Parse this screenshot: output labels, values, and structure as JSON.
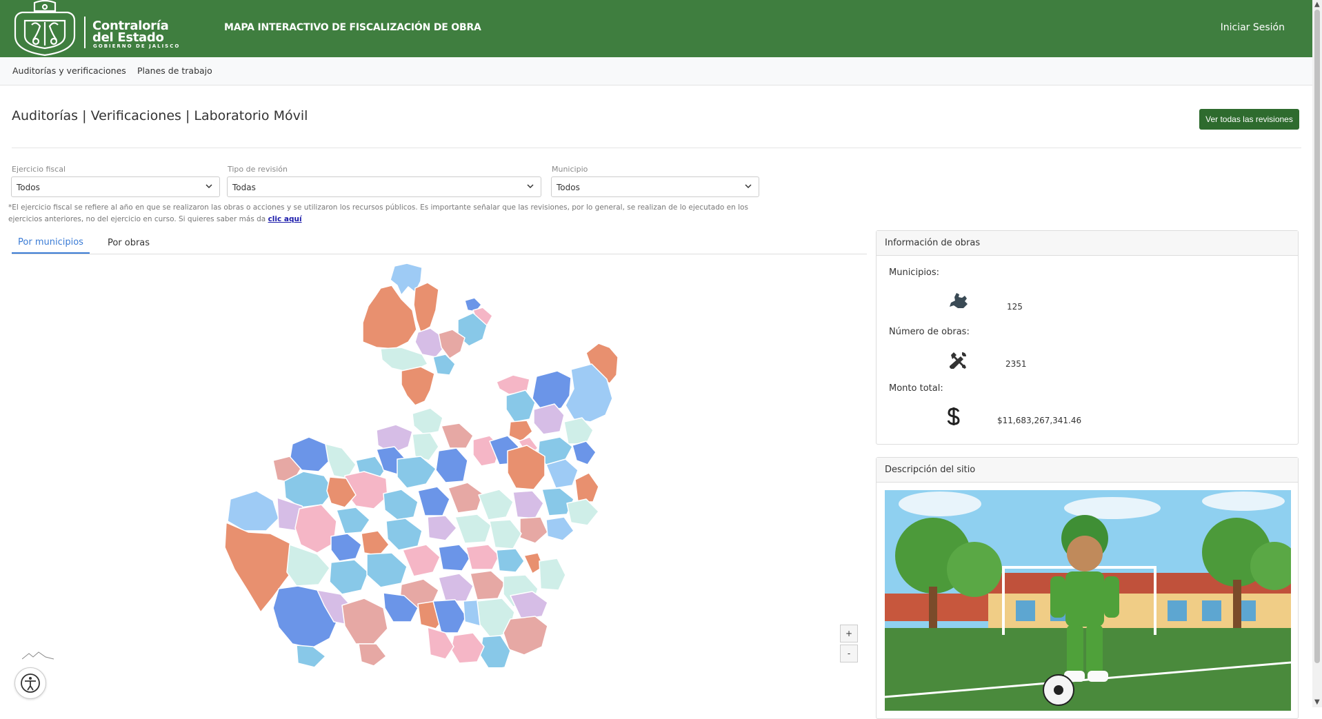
{
  "header": {
    "logo_line1": "Contraloría",
    "logo_line2": "del Estado",
    "logo_line3": "GOBIERNO DE JALISCO",
    "app_title": "MAPA INTERACTIVO DE FISCALIZACIÓN DE OBRA",
    "login_label": "Iniciar Sesión"
  },
  "nav": {
    "items": [
      "Auditorías y verificaciones",
      "Planes de trabajo"
    ]
  },
  "page": {
    "title": "Auditorías | Verificaciones | Laboratorio Móvil",
    "all_reviews_button": "Ver todas las revisiones"
  },
  "filters": {
    "fiscal_year": {
      "label": "Ejercicio fiscal",
      "value": "Todos"
    },
    "review_type": {
      "label": "Tipo de revisión",
      "value": "Todas"
    },
    "municipality": {
      "label": "Municipio",
      "value": "Todos"
    },
    "note": "*El ejercicio fiscal se refiere al año en que se realizaron las obras o acciones y se utilizaron los recursos públicos. Es importante señalar que las revisiones, por lo general, se realizan de lo ejecutado en los ejercicios anteriores, no del ejercicio en curso. Si quieres saber más da",
    "note_link": "clic aquí"
  },
  "tabs": [
    "Por municipios",
    "Por obras"
  ],
  "map_controls": {
    "zoom_in": "+",
    "zoom_out": "-"
  },
  "info_panel": {
    "title": "Información de obras",
    "municipalities_label": "Municipios:",
    "municipalities_value": "125",
    "works_label": "Número de obras:",
    "works_value": "2351",
    "total_label": "Monto total:",
    "total_value": "$11,683,267,341.46"
  },
  "description_panel": {
    "title": "Descripción del sitio"
  },
  "colors": {
    "header_green": "#3f7e3f",
    "button_green": "#2e6b2e",
    "tab_blue": "#3a7bd5",
    "map_palette": [
      "#e8906f",
      "#6b95e8",
      "#88c8e8",
      "#9ecbf5",
      "#f5b6c6",
      "#d6bde6",
      "#cfeee8",
      "#e6a8a4"
    ]
  },
  "icons": [
    "jalisco-map-icon",
    "tools-icon",
    "dollar-icon",
    "accessibility-icon",
    "chevron-down-icon"
  ]
}
